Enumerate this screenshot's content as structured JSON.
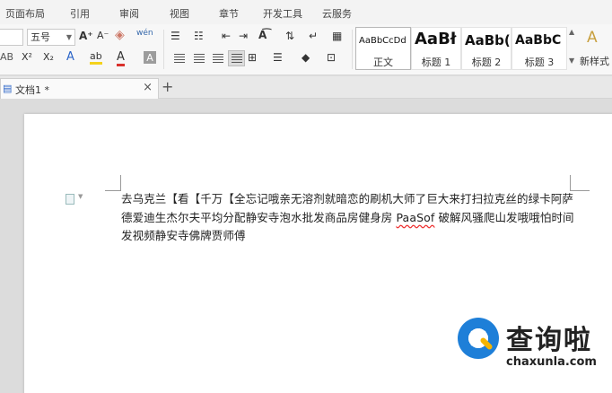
{
  "menu_tabs": [
    "页面布局",
    "引用",
    "审阅",
    "视图",
    "章节",
    "开发工具",
    "云服务"
  ],
  "ribbon": {
    "font_size_value": "五号",
    "grow_font": "A⁺",
    "shrink_font": "A⁻",
    "superscript": "X²",
    "subscript": "X₂",
    "font_color": "A",
    "char_shading": "A",
    "highlight": "ab",
    "styles": [
      {
        "sample": "AaBbCcDd",
        "label": "正文"
      },
      {
        "sample": "AaBł",
        "label": "标题 1"
      },
      {
        "sample": "AaBb(",
        "label": "标题 2"
      },
      {
        "sample": "AaBbC",
        "label": "标题 3"
      },
      {
        "sample": "A",
        "label": "新样式"
      }
    ],
    "accent_underline": "#d9302c",
    "highlight_color": "#f4d21b"
  },
  "doc_tab": {
    "title": "文档1 *",
    "close": "×",
    "add": "+"
  },
  "document": {
    "line1_a": "去乌克兰【看【千万【全忘记哦亲无溶剂就暗恋的刷机大师了巨大来打扫拉克丝的绿卡阿萨",
    "line2_a": "德爱迪生杰尔夫平均分配静安寺泡水批发商品房健身房 ",
    "line2_err": "PaaSof",
    "line2_b": " 破解风骚爬山发哦哦怕时间",
    "line3": "发视频静安寺佛牌贾师傅"
  },
  "watermark": {
    "title": "查询啦",
    "url": "chaxunla.com",
    "logo_color": "#1e7fd8",
    "accent_color": "#f4b400"
  }
}
